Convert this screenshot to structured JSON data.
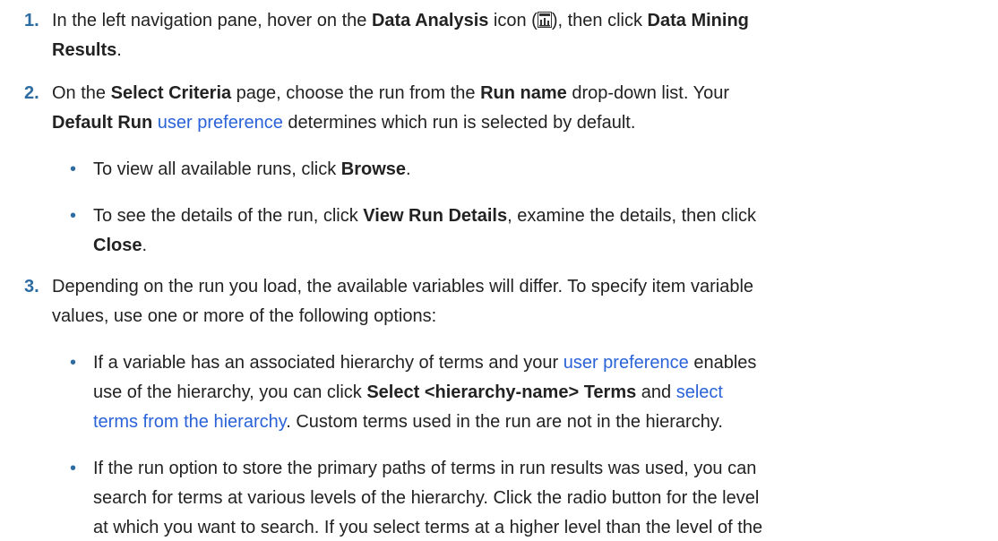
{
  "steps": [
    {
      "number": "1.",
      "lines": [
        {
          "pre": "In the left navigation pane, hover on the ",
          "b1": "Data Analysis",
          "mid": " icon (",
          "post": "), then click ",
          "b2": "Data Mining"
        },
        {
          "b1": "Results",
          "post": "."
        }
      ],
      "icon": "data-analysis-icon"
    },
    {
      "number": "2.",
      "lines": [
        {
          "pre": "On the ",
          "b1": "Select Criteria",
          "mid": " page, choose the run from the ",
          "b2": "Run name",
          "post": " drop-down list. Your"
        },
        {
          "b1": "Default Run",
          "link": "user preference",
          "post": " determines which run is selected by default."
        }
      ],
      "bullets": [
        {
          "pre": "To view all available runs, click ",
          "b1": "Browse",
          "post": "."
        },
        {
          "pre": "To see the details of the run, click ",
          "b1": "View Run Details",
          "post": ", examine the details, then click",
          "line2b": "Close",
          "line2post": "."
        }
      ]
    },
    {
      "number": "3.",
      "lines": [
        {
          "text": "Depending on the run you load, the available variables will differ. To specify item variable"
        },
        {
          "text": "values, use one or more of the following options:"
        }
      ],
      "bullets": [
        {
          "l1pre": "If a variable has an associated hierarchy of terms and your ",
          "l1link": "user preference",
          "l1post": " enables",
          "l2pre": "use of the hierarchy, you can click ",
          "l2b": "Select <hierarchy-name> Terms",
          "l2mid": " and ",
          "l2link": "select",
          "l3link": "terms from the hierarchy",
          "l3post": ". Custom terms used in the run are not in the hierarchy."
        },
        {
          "l1": "If the run option to store the primary paths of terms in run results was used, you can",
          "l2": "search for terms at various levels of the hierarchy. Click the radio button for the level",
          "l3": "at which you want to search. If you select terms at a higher level than the level of the"
        }
      ]
    }
  ],
  "colors": {
    "number": "#2d6ca2",
    "link": "#2a62d8",
    "text": "#222222"
  }
}
